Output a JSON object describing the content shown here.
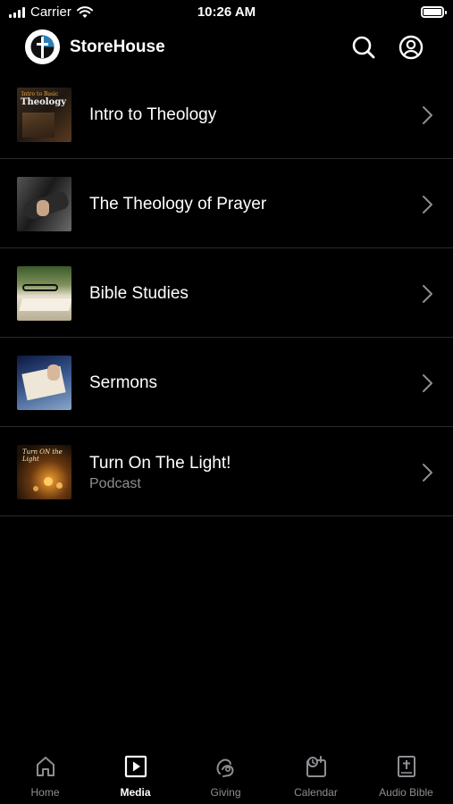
{
  "status_bar": {
    "carrier": "Carrier",
    "time": "10:26 AM",
    "battery_level": 1.0,
    "icons": [
      "signal-icon",
      "wifi-icon",
      "battery-icon"
    ]
  },
  "header": {
    "title": "StoreHouse",
    "icons": [
      "logo-icon",
      "search-icon",
      "account-icon"
    ]
  },
  "media_list": [
    {
      "title": "Intro to Theology",
      "thumb_text_top": "Intro to Basic",
      "thumb_text_main": "Theology"
    },
    {
      "title": "The Theology of Prayer"
    },
    {
      "title": "Bible Studies"
    },
    {
      "title": "Sermons"
    },
    {
      "title": "Turn On The Light!",
      "subtitle": "Podcast",
      "thumb_text": "Turn ON the Light"
    }
  ],
  "tabs": [
    {
      "label": "Home",
      "icon": "home-icon",
      "active": false
    },
    {
      "label": "Media",
      "icon": "play-icon",
      "active": true
    },
    {
      "label": "Giving",
      "icon": "giving-icon",
      "active": false
    },
    {
      "label": "Calendar",
      "icon": "calendar-icon",
      "active": false
    },
    {
      "label": "Audio Bible",
      "icon": "bible-icon",
      "active": false
    }
  ],
  "colors": {
    "background": "#000000",
    "text_primary": "#ffffff",
    "text_secondary": "#8e8e93",
    "divider": "#2a2a2a"
  }
}
